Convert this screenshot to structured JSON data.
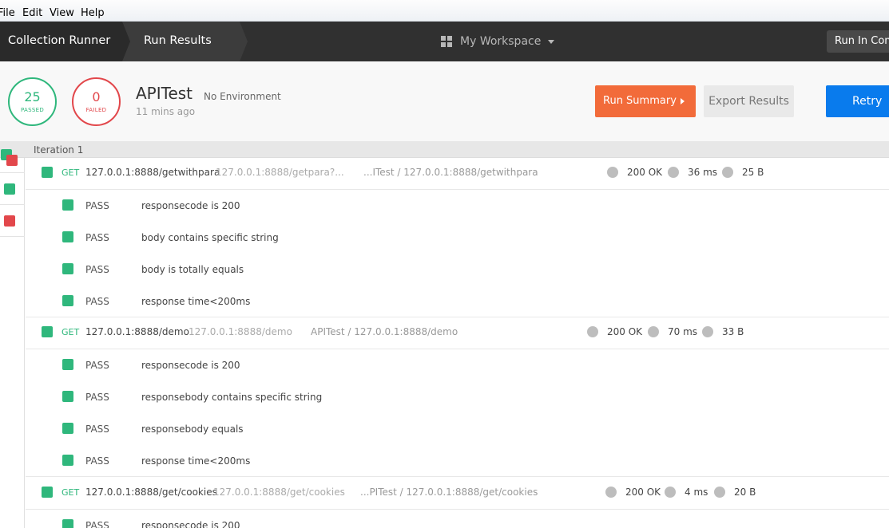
{
  "menu": [
    "File",
    "Edit",
    "View",
    "Help"
  ],
  "header": {
    "crumb_runner": "Collection Runner",
    "crumb_results": "Run Results",
    "workspace": "My Workspace",
    "run_in_cmd": "Run In Command"
  },
  "summary": {
    "passed_count": "25",
    "passed_label": "PASSED",
    "failed_count": "0",
    "failed_label": "FAILED",
    "collection": "APITest",
    "environment": "No Environment",
    "time_ago": "11 mins ago",
    "btn_run_summary": "Run Summary",
    "btn_export": "Export Results",
    "btn_retry": "Retry"
  },
  "iteration_label": "Iteration 1",
  "requests": [
    {
      "method": "GET",
      "name": "127.0.0.1:8888/getwithpara",
      "url": "127.0.0.1:8888/getpara?...",
      "path": "...ITest / 127.0.0.1:8888/getwithpara",
      "status": "200 OK",
      "time": "36 ms",
      "size": "25 B",
      "tests": [
        {
          "result": "PASS",
          "name": "responsecode is 200"
        },
        {
          "result": "PASS",
          "name": "body contains specific string"
        },
        {
          "result": "PASS",
          "name": "body is totally equals"
        },
        {
          "result": "PASS",
          "name": "response time<200ms"
        }
      ]
    },
    {
      "method": "GET",
      "name": "127.0.0.1:8888/demo",
      "url": "127.0.0.1:8888/demo",
      "path": "APITest / 127.0.0.1:8888/demo",
      "status": "200 OK",
      "time": "70 ms",
      "size": "33 B",
      "tests": [
        {
          "result": "PASS",
          "name": "responsecode is 200"
        },
        {
          "result": "PASS",
          "name": "responsebody contains specific string"
        },
        {
          "result": "PASS",
          "name": "responsebody equals"
        },
        {
          "result": "PASS",
          "name": "response time<200ms"
        }
      ]
    },
    {
      "method": "GET",
      "name": "127.0.0.1:8888/get/cookies",
      "url": "127.0.0.1:8888/get/cookies",
      "path": "...PITest / 127.0.0.1:8888/get/cookies",
      "status": "200 OK",
      "time": "4 ms",
      "size": "20 B",
      "tests": [
        {
          "result": "PASS",
          "name": "responsecode is 200"
        }
      ]
    }
  ],
  "colors": {
    "pass": "#2fb77c",
    "fail": "#e2474b",
    "accent_orange": "#f26b3a",
    "accent_blue": "#097bed"
  }
}
